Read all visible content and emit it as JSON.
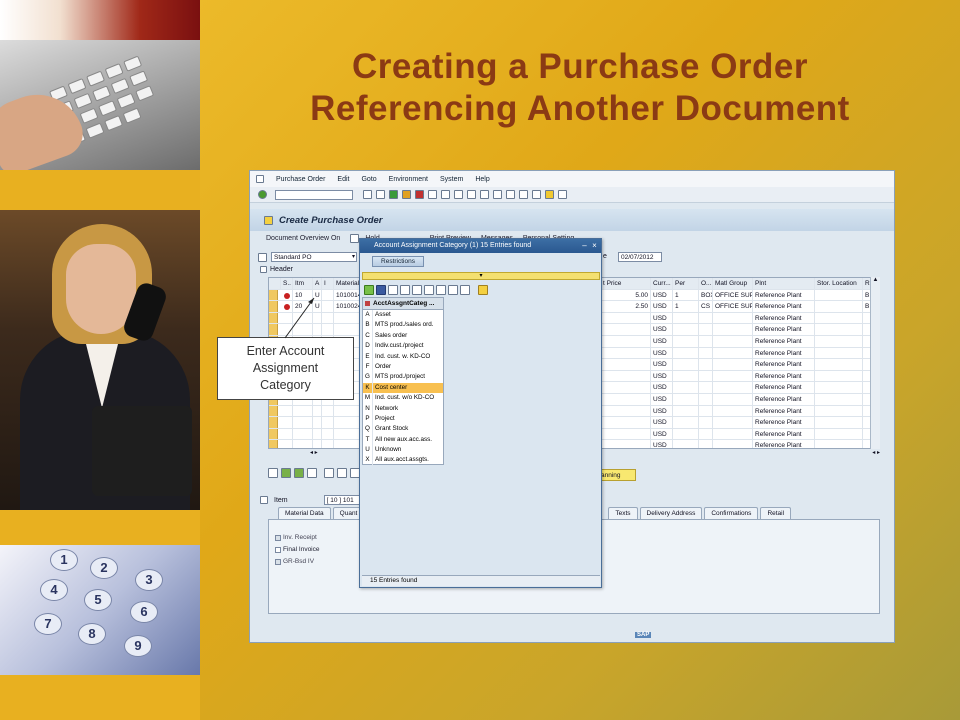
{
  "slide": {
    "title_line1": "Creating a Purchase Order",
    "title_line2": "Referencing Another Document"
  },
  "sap": {
    "menu": [
      "Purchase Order",
      "Edit",
      "Goto",
      "Environment",
      "System",
      "Help"
    ],
    "screen_title": "Create Purchase Order",
    "app_toolbar": [
      "Document Overview On",
      "Hold",
      "Print Preview",
      "Messages",
      "Personal Setting"
    ],
    "doc_type": "Standard PO",
    "date_label": "e",
    "doc_date": "02/07/2012",
    "header_label": "Header",
    "grid_columns": [
      "S..",
      "Itm",
      "A",
      "I",
      "Material",
      "t Price",
      "Curr...",
      "Per",
      "O...",
      "Matl Group",
      "Plnt",
      "Stor. Location",
      "R"
    ],
    "items": [
      {
        "itm": "10",
        "a": "U",
        "material": "1010014",
        "price": "5.00",
        "curr": "USD",
        "per": "1",
        "oun": "BOX",
        "matl_group": "OFFICE SUP...",
        "plant": "Reference Plant",
        "r": "B"
      },
      {
        "itm": "20",
        "a": "U",
        "material": "1010024",
        "price": "2.50",
        "curr": "USD",
        "per": "1",
        "oun": "CS",
        "matl_group": "OFFICE SUP...",
        "plant": "Reference Plant",
        "r": "B"
      }
    ],
    "empty_row_curr": "USD",
    "empty_row_plant": "Reference Plant",
    "planning_label": "anning",
    "item_label": "Item",
    "item_value": "[ 10 ] 101",
    "tabs": [
      "Material Data",
      "Quant",
      "Texts",
      "Delivery Address",
      "Confirmations",
      "Retail"
    ],
    "checkboxes": [
      "Inv. Receipt",
      "Final Invoice",
      "GR-Bsd IV"
    ],
    "sap_logo": "SAP"
  },
  "dialog": {
    "title": "Account Assignment Category (1)   15 Entries found",
    "restrictions_tab": "Restrictions",
    "column_header": "AcctAssgntCateg ...",
    "entries": [
      {
        "code": "A",
        "text": "Asset"
      },
      {
        "code": "B",
        "text": "MTS prod./sales ord."
      },
      {
        "code": "C",
        "text": "Sales order"
      },
      {
        "code": "D",
        "text": "Indiv.cust./project"
      },
      {
        "code": "E",
        "text": "Ind. cust. w. KD-CO"
      },
      {
        "code": "F",
        "text": "Order"
      },
      {
        "code": "G",
        "text": "MTS prod./project"
      },
      {
        "code": "K",
        "text": "Cost center"
      },
      {
        "code": "M",
        "text": "Ind. cust. w/o KD-CO"
      },
      {
        "code": "N",
        "text": "Network"
      },
      {
        "code": "P",
        "text": "Project"
      },
      {
        "code": "Q",
        "text": "Grant Stock"
      },
      {
        "code": "T",
        "text": "All new aux.acc.ass."
      },
      {
        "code": "U",
        "text": "Unknown"
      },
      {
        "code": "X",
        "text": "All aux.acct.assgts."
      }
    ],
    "selected_code": "K",
    "status": "15 Entries found"
  },
  "callout": {
    "line1": "Enter Account",
    "line2": "Assignment",
    "line3": "Category"
  },
  "colors": {
    "title": "#8b3a14",
    "background": "#e0a818",
    "selection": "#f8c050",
    "dialog_title": "#2a5890"
  }
}
